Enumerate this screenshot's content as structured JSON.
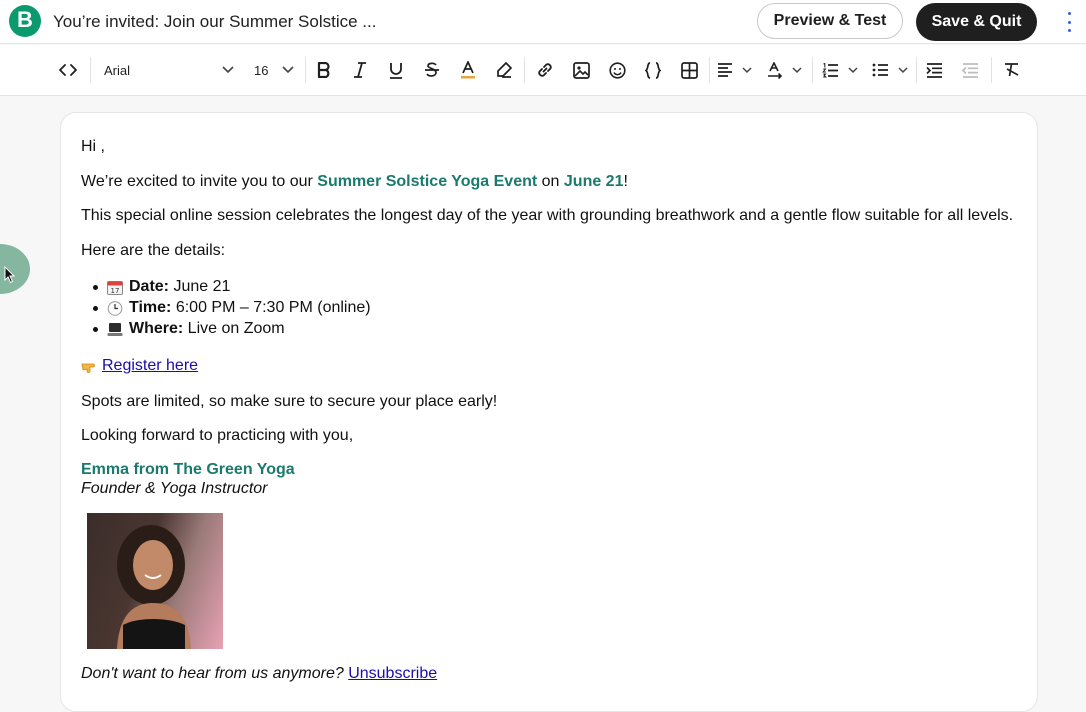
{
  "header": {
    "logo_letter": "B",
    "title": "You’re invited: Join our Summer Solstice ...",
    "preview_label": "Preview & Test",
    "save_label": "Save & Quit"
  },
  "toolbar": {
    "font_family": "Arial",
    "font_size": "16",
    "icons": [
      "code-view-icon",
      "font-family-select",
      "font-size-select",
      "bold-icon",
      "italic-icon",
      "underline-icon",
      "strikethrough-icon",
      "text-color-icon",
      "highlight-icon",
      "link-icon",
      "image-icon",
      "emoji-icon",
      "variables-icon",
      "table-icon",
      "align-icon",
      "text-direction-icon",
      "ordered-list-icon",
      "bullet-list-icon",
      "indent-icon",
      "outdent-icon",
      "clear-format-icon"
    ]
  },
  "email": {
    "greeting": "Hi ,",
    "intro_prefix": "We’re excited to invite you to our ",
    "event_name": "Summer Solstice Yoga Event",
    "intro_mid": " on ",
    "event_date": "June 21",
    "intro_suffix": "!",
    "description": "This special online session celebrates the longest day of the year with grounding breathwork and a gentle flow suitable for all levels.",
    "details_heading": "Here are the details:",
    "details": [
      {
        "label": "Date:",
        "value": " June 21"
      },
      {
        "label": "Time:",
        "value": " 6:00 PM – 7:30 PM (online)"
      },
      {
        "label": "Where:",
        "value": " Live on Zoom"
      }
    ],
    "register_link": "Register here",
    "spots": "Spots are limited, so make sure to secure your place early!",
    "closing": "Looking forward to practicing with you,",
    "signature_name": "Emma from The Green Yoga",
    "signature_role": "Founder & Yoga Instructor",
    "unsubscribe_prefix": "Don't want to hear from us anymore? ",
    "unsubscribe_link": "Unsubscribe"
  },
  "colors": {
    "brand": "#0b996e",
    "accent_text": "#1a7a6e",
    "link": "#1a0dab"
  }
}
